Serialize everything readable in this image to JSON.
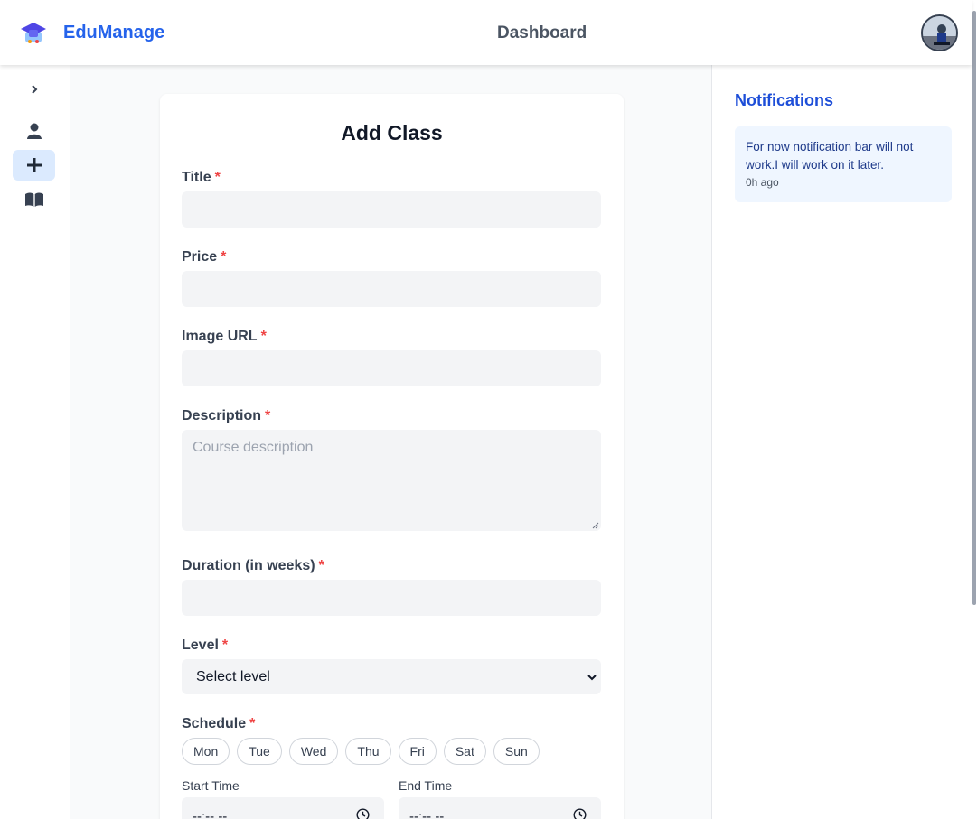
{
  "header": {
    "brand": "EduManage",
    "page_title": "Dashboard"
  },
  "sidebar": {
    "items": [
      {
        "icon": "chevron-right-icon"
      },
      {
        "icon": "user-icon"
      },
      {
        "icon": "plus-icon",
        "active": true
      },
      {
        "icon": "book-icon"
      }
    ]
  },
  "form": {
    "title": "Add Class",
    "required_mark": "*",
    "fields": {
      "title": {
        "label": "Title"
      },
      "price": {
        "label": "Price"
      },
      "image_url": {
        "label": "Image URL"
      },
      "description": {
        "label": "Description",
        "placeholder": "Course description"
      },
      "duration": {
        "label": "Duration (in weeks)"
      },
      "level": {
        "label": "Level",
        "selected": "Select level"
      }
    },
    "schedule": {
      "label": "Schedule",
      "days": [
        "Mon",
        "Tue",
        "Wed",
        "Thu",
        "Fri",
        "Sat",
        "Sun"
      ]
    },
    "start_time": {
      "label": "Start Time",
      "value": "--:-- --"
    },
    "end_time": {
      "label": "End Time",
      "value": "--:-- --"
    }
  },
  "notifications": {
    "title": "Notifications",
    "items": [
      {
        "message": "For now notification bar will not work.I will work on it later.",
        "time": "0h ago"
      }
    ]
  },
  "colors": {
    "brand": "#2563eb",
    "required": "#ef4444",
    "active_bg": "#dbeafe",
    "notif_bg": "#eff6ff"
  }
}
